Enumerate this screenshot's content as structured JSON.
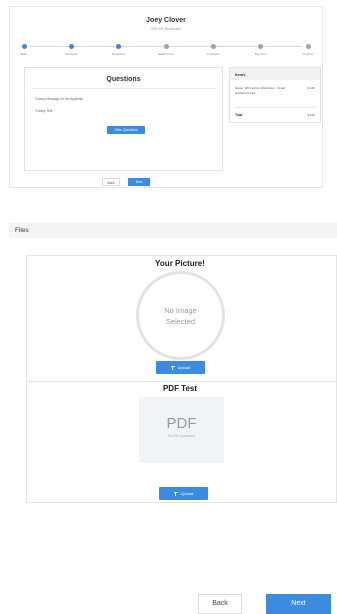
{
  "preview": {
    "name": "Joey Clover",
    "subtitle": "000 000 Broadcast",
    "steps": [
      {
        "label": "Basic",
        "done": true
      },
      {
        "label": "Products",
        "done": true
      },
      {
        "label": "Questions",
        "done": true
      },
      {
        "label": "Health Form",
        "done": false
      },
      {
        "label": "Contracts",
        "done": false
      },
      {
        "label": "Payment",
        "done": false
      },
      {
        "label": "Confirm",
        "done": false
      }
    ],
    "questions": {
      "title": "Questions",
      "lines": [
        "Yummy Message for the Applicant",
        "Yummy Test"
      ],
      "button": "Other Questions"
    },
    "summary": {
      "title": "Items",
      "item": "Name: With apt for Distinction - Small Enrollment Fee",
      "price": "$ 100",
      "total_label": "Total",
      "total_price": "$ 100"
    },
    "back": "Back",
    "next": "Next"
  },
  "files": {
    "header": "Files",
    "picture": {
      "title": "Your Picture!",
      "placeholder_line1": "No Image",
      "placeholder_line2": "Selected",
      "upload": "Upload"
    },
    "pdf": {
      "title": "PDF Test",
      "placeholder": "PDF",
      "placeholder_sub": "No File Uploaded",
      "upload": "Upload"
    }
  },
  "nav": {
    "back": "Back",
    "next": "Next"
  },
  "colors": {
    "accent": "#3b8be0",
    "panel_bg": "#f4f4f4",
    "border": "#e4e4e4"
  }
}
